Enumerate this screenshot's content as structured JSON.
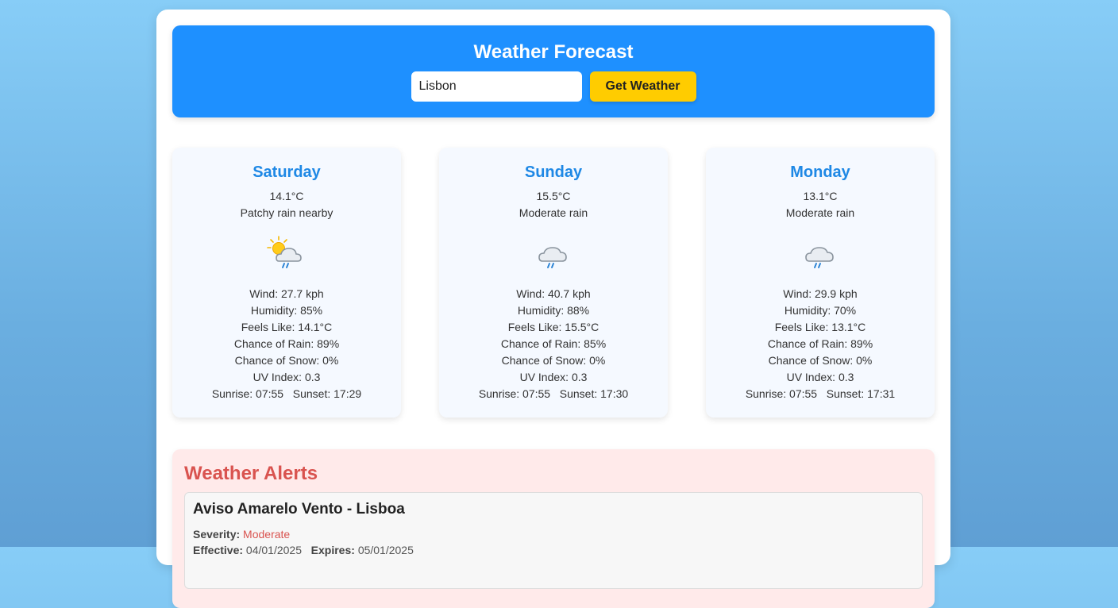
{
  "header": {
    "title": "Weather Forecast",
    "search_value": "Lisbon",
    "button_label": "Get Weather",
    "accent": "#1e90ff",
    "button_color": "#ffcc00"
  },
  "forecast": [
    {
      "day": "Saturday",
      "temp": "14.1°C",
      "condition": "Patchy rain nearby",
      "icon": "sun-cloud-rain-icon",
      "wind": "Wind: 27.7 kph",
      "humidity": "Humidity: 85%",
      "feels_like": "Feels Like: 14.1°C",
      "rain": "Chance of Rain: 89%",
      "snow": "Chance of Snow: 0%",
      "uv": "UV Index: 0.3",
      "sun": "Sunrise: 07:55   Sunset: 17:29"
    },
    {
      "day": "Sunday",
      "temp": "15.5°C",
      "condition": "Moderate rain",
      "icon": "cloud-rain-icon",
      "wind": "Wind: 40.7 kph",
      "humidity": "Humidity: 88%",
      "feels_like": "Feels Like: 15.5°C",
      "rain": "Chance of Rain: 85%",
      "snow": "Chance of Snow: 0%",
      "uv": "UV Index: 0.3",
      "sun": "Sunrise: 07:55   Sunset: 17:30"
    },
    {
      "day": "Monday",
      "temp": "13.1°C",
      "condition": "Moderate rain",
      "icon": "cloud-rain-icon",
      "wind": "Wind: 29.9 kph",
      "humidity": "Humidity: 70%",
      "feels_like": "Feels Like: 13.1°C",
      "rain": "Chance of Rain: 89%",
      "snow": "Chance of Snow: 0%",
      "uv": "UV Index: 0.3",
      "sun": "Sunrise: 07:55   Sunset: 17:31"
    }
  ],
  "alerts": {
    "title": "Weather Alerts",
    "items": [
      {
        "headline": "Aviso Amarelo Vento - Lisboa",
        "severity_label": "Severity:",
        "severity_value": "Moderate",
        "effective_label": "Effective:",
        "effective_value": "04/01/2025",
        "expires_label": "Expires:",
        "expires_value": "05/01/2025"
      }
    ]
  }
}
